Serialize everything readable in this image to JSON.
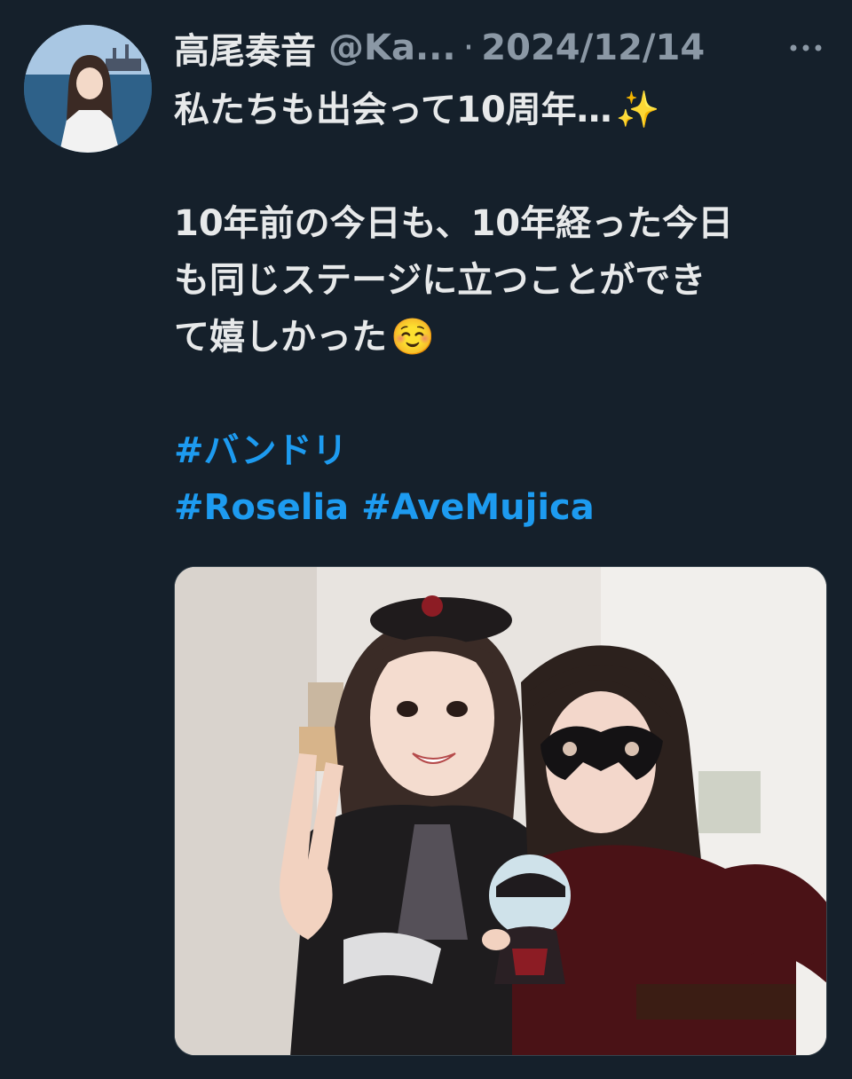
{
  "tweet": {
    "display_name": "高尾奏音",
    "handle": "@Ka...",
    "separator": "·",
    "date": "2024/12/14",
    "more_icon": "more-horizontal-icon",
    "body": {
      "line1": "私たちも出会って10周年…",
      "line1_emoji": "✨",
      "line2": "10年前の今日も、10年経った今日",
      "line3": "も同じステージに立つことができ",
      "line4": "て嬉しかった",
      "line4_emoji": "☺️",
      "hashtags": {
        "bandori": "#バンドリ",
        "roselia": "#Roselia",
        "avemujica": "#AveMujica"
      }
    },
    "media_alt": "photo"
  },
  "colors": {
    "background": "#15202b",
    "text": "#e7e9ea",
    "muted": "#8b98a5",
    "link": "#1d9bf0"
  }
}
